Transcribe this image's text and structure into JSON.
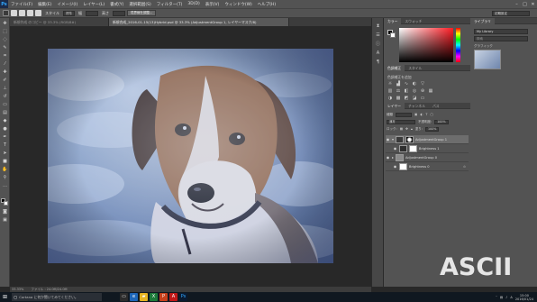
{
  "menubar": {
    "logo": "Ps",
    "items": [
      "ファイル(F)",
      "編集(E)",
      "イメージ(I)",
      "レイヤー(L)",
      "書式(Y)",
      "選択範囲(S)",
      "フィルター(T)",
      "3D(D)",
      "表示(V)",
      "ウィンドウ(W)",
      "ヘルプ(H)"
    ],
    "controls": [
      "–",
      "□",
      "✕"
    ]
  },
  "optionsbar": {
    "mode_label": "スタイル",
    "mode_value": "標準",
    "width_label": "幅",
    "height_label": "高さ",
    "refine_button": "境界線を調整...",
    "workspace": "初期設定"
  },
  "tabs": [
    {
      "label": "新規作成 のコピー @ 33.3% (RGB/8#)",
      "active": false
    },
    {
      "label": "新規合成_2016-01-15(13)Hybrid.psd @ 33.3% (AdjustmentGroup 1, レイヤーマスク/8)",
      "active": true
    }
  ],
  "status": {
    "zoom": "33.33%",
    "doc": "ファイル : 24.0M/24.0M"
  },
  "panels": {
    "color": {
      "tabs": [
        "カラー",
        "スウォッチ"
      ]
    },
    "libraries": {
      "tabs": [
        "ライブラリ"
      ],
      "library_name": "My Library",
      "search_placeholder": "検索",
      "group_label": "グラフィック",
      "thumb_caption": "新規合成_2016..."
    },
    "adjustments": {
      "tabs": [
        "色調補正",
        "スタイル"
      ],
      "title": "色調補正を追加"
    },
    "layers": {
      "tabs": [
        "レイヤー",
        "チャンネル",
        "パス"
      ],
      "kind_label": "種類",
      "blend_mode": "通常",
      "opacity_label": "不透明度:",
      "opacity_value": "100%",
      "lock_label": "ロック:",
      "fill_label": "塗り:",
      "fill_value": "100%",
      "rows": [
        {
          "name": "AdjustmentGroup 1",
          "selected": true,
          "indent": 0,
          "thumb": "mask"
        },
        {
          "name": "Brightness 1",
          "selected": false,
          "indent": 1,
          "thumb": "adjust"
        },
        {
          "name": "AdjustmentGroup 0",
          "selected": false,
          "indent": 0,
          "thumb": "folder"
        },
        {
          "name": "Brightness 0",
          "selected": false,
          "indent": 1,
          "thumb": "adjust"
        }
      ]
    }
  },
  "taskbar": {
    "search_text": "Cortana に何か聞いてみてください。",
    "time": "15:00",
    "date": "2016/01/24"
  },
  "watermark": "ASCII",
  "colors": {
    "ui_dark": "#282828",
    "panel": "#535353",
    "sky": "#6f87b2",
    "selection": "#6d6d6d"
  }
}
